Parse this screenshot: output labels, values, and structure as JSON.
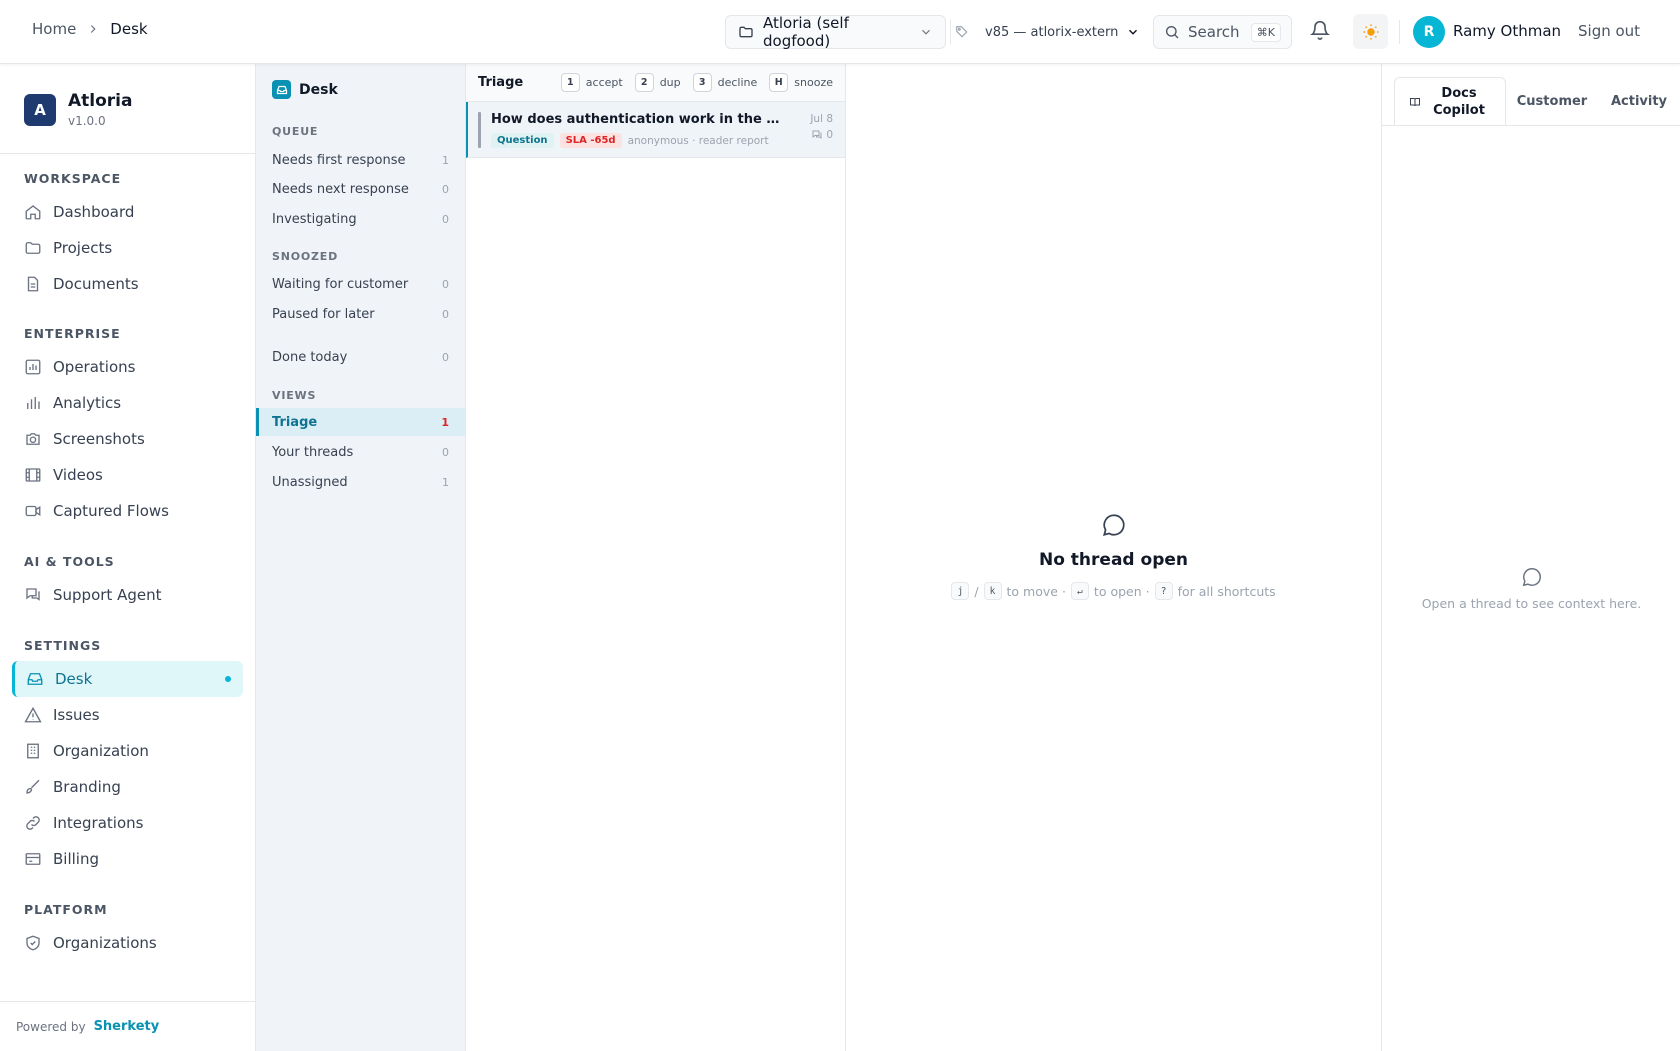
{
  "header": {
    "breadcrumb_home": "Home",
    "breadcrumb_current": "Desk",
    "project": "Atloria (self dogfood)",
    "version": "v85 — atlorix-extern",
    "search_label": "Search",
    "search_shortcut": "⌘K",
    "user_initial": "R",
    "user_name": "Ramy Othman",
    "sign_out": "Sign out"
  },
  "brand": {
    "logo_letter": "A",
    "name": "Atloria",
    "version": "v1.0.0"
  },
  "nav": {
    "workspace": "WORKSPACE",
    "dashboard": "Dashboard",
    "projects": "Projects",
    "documents": "Documents",
    "enterprise": "ENTERPRISE",
    "operations": "Operations",
    "analytics": "Analytics",
    "screenshots": "Screenshots",
    "videos": "Videos",
    "captured_flows": "Captured Flows",
    "ai_tools": "AI & TOOLS",
    "support_agent": "Support Agent",
    "settings": "SETTINGS",
    "desk": "Desk",
    "issues": "Issues",
    "organization": "Organization",
    "branding": "Branding",
    "integrations": "Integrations",
    "billing": "Billing",
    "platform": "PLATFORM",
    "organizations": "Organizations",
    "powered_by": "Powered by",
    "company": "Sherkety"
  },
  "desk": {
    "title": "Desk",
    "queue": "QUEUE",
    "needs_first": {
      "label": "Needs first response",
      "count": "1"
    },
    "needs_next": {
      "label": "Needs next response",
      "count": "0"
    },
    "investigating": {
      "label": "Investigating",
      "count": "0"
    },
    "snoozed": "SNOOZED",
    "waiting": {
      "label": "Waiting for customer",
      "count": "0"
    },
    "paused": {
      "label": "Paused for later",
      "count": "0"
    },
    "done_today": {
      "label": "Done today",
      "count": "0"
    },
    "views": "VIEWS",
    "triage": {
      "label": "Triage",
      "count": "1"
    },
    "your_threads": {
      "label": "Your threads",
      "count": "0"
    },
    "unassigned": {
      "label": "Unassigned",
      "count": "1"
    }
  },
  "threads": {
    "header": "Triage",
    "shortcuts": [
      {
        "key": "1",
        "label": "accept"
      },
      {
        "key": "2",
        "label": "dup"
      },
      {
        "key": "3",
        "label": "decline"
      },
      {
        "key": "H",
        "label": "snooze"
      }
    ],
    "items": [
      {
        "title": "How does authentication work in the API?",
        "type": "Question",
        "sla": "SLA -65d",
        "who": "anonymous · reader report",
        "date": "Jul 8",
        "replies": "0"
      }
    ]
  },
  "main": {
    "empty_title": "No thread open",
    "hint_j": "j",
    "hint_slash": "/",
    "hint_k": "k",
    "hint_move": "to move ·",
    "hint_enter": "↵",
    "hint_open": "to open ·",
    "hint_q": "?",
    "hint_all": "for all shortcuts"
  },
  "context": {
    "tab_copilot": "Docs Copilot",
    "tab_customer": "Customer",
    "tab_activity": "Activity",
    "empty_text": "Open a thread to see context here."
  },
  "colors": {
    "accent": "#06b6d4",
    "brand_logo": "#1e3a6e",
    "sla_red": "#dc2626"
  }
}
